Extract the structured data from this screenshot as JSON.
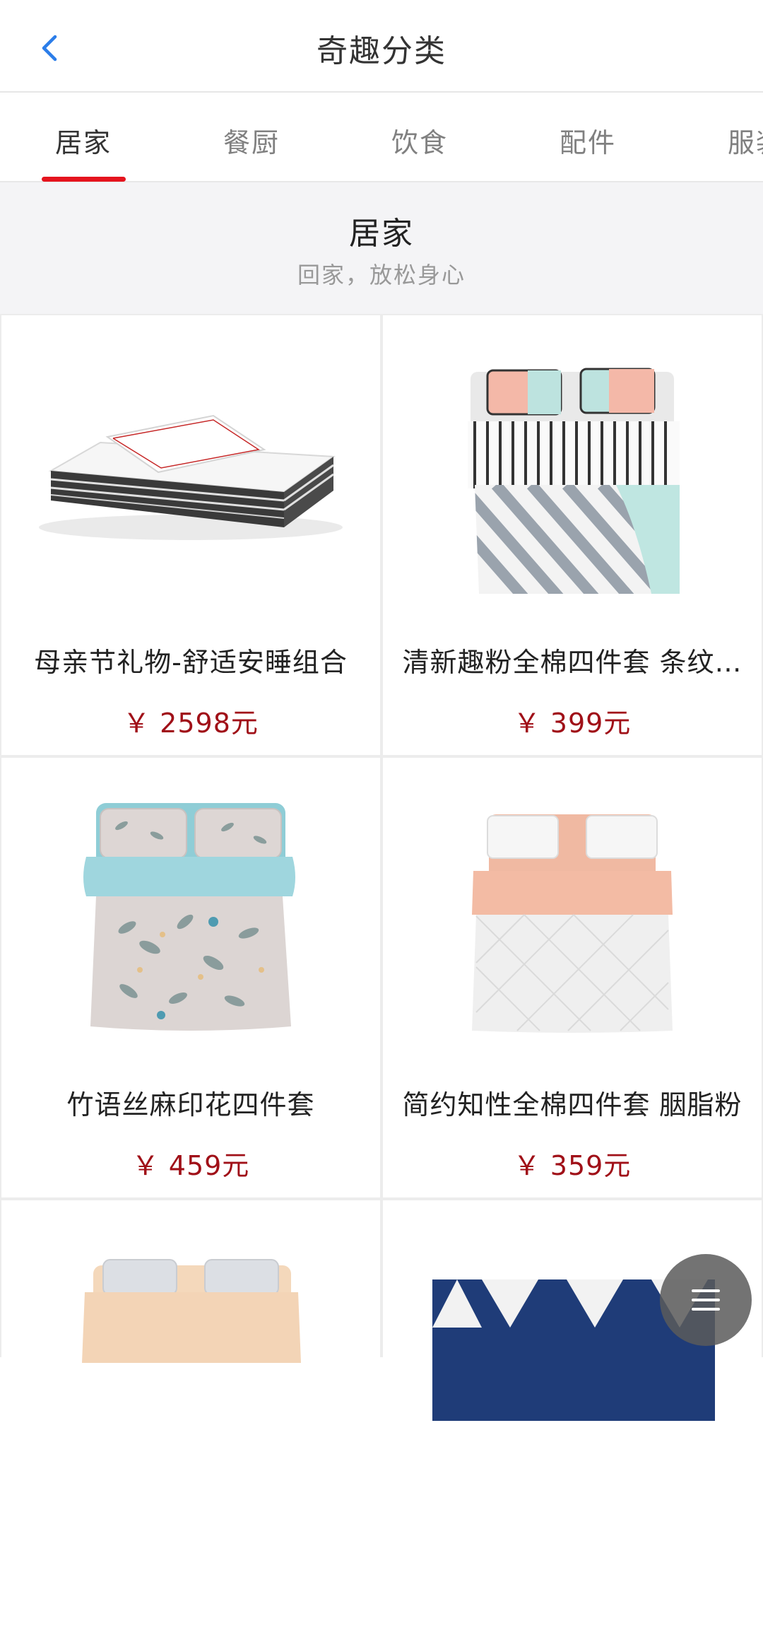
{
  "header": {
    "title": "奇趣分类"
  },
  "tabs": [
    {
      "label": "居家",
      "active": true
    },
    {
      "label": "餐厨",
      "active": false
    },
    {
      "label": "饮食",
      "active": false
    },
    {
      "label": "配件",
      "active": false
    },
    {
      "label": "服装",
      "active": false
    }
  ],
  "section": {
    "title": "居家",
    "subtitle": "回家，放松身心"
  },
  "products": [
    {
      "name": "母亲节礼物-舒适安睡组合",
      "price": "￥ 2598元"
    },
    {
      "name": "清新趣粉全棉四件套 条纹…",
      "price": "￥ 399元"
    },
    {
      "name": "竹语丝麻印花四件套",
      "price": "￥ 459元"
    },
    {
      "name": "简约知性全棉四件套 胭脂粉",
      "price": "￥ 359元"
    },
    {
      "name": "",
      "price": ""
    },
    {
      "name": "",
      "price": ""
    }
  ],
  "colors": {
    "accent": "#e5141e",
    "price": "#a01018",
    "background": "#f4f4f6"
  },
  "icons": {
    "back": "chevron-left-icon",
    "menu": "hamburger-menu-icon"
  }
}
